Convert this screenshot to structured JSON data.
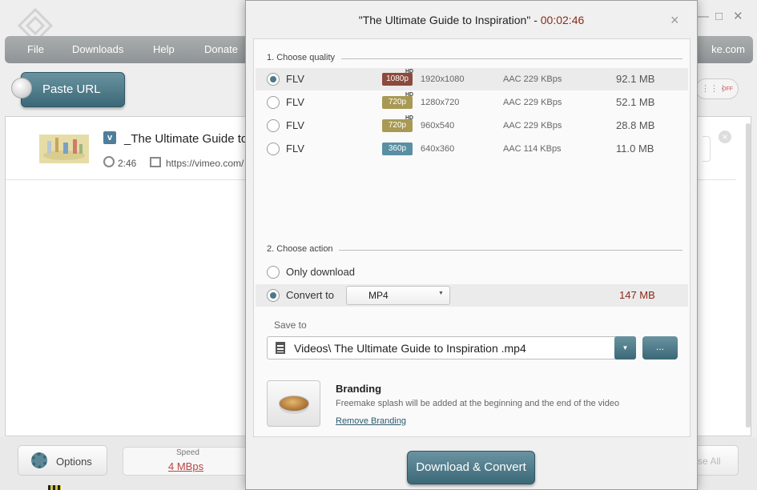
{
  "app": {
    "menu": [
      "File",
      "Downloads",
      "Help",
      "Donate"
    ],
    "brand": "ke.com",
    "paste_url": "Paste URL",
    "toggle_off": "OFF",
    "item": {
      "title": "_The Ultimate Guide to In",
      "duration": "2:46",
      "url": "https://vimeo.com/",
      "source_badge": "v"
    },
    "bottom": {
      "options": "Options",
      "speed_label": "Speed",
      "speed_value": "4  MBps",
      "all_button": "se All"
    }
  },
  "dialog": {
    "title": "\"The Ultimate Guide to Inspiration\" - ",
    "duration": "00:02:46",
    "close": "×",
    "quality_heading": "1. Choose quality",
    "quality_options": [
      {
        "format": "FLV",
        "badge": "1080p",
        "hd": "HD",
        "badge_color": "#8b4a3c",
        "resolution": "1920x1080",
        "audio": "AAC 229  KBps",
        "size": "92.1 MB",
        "selected": true
      },
      {
        "format": "FLV",
        "badge": "720p",
        "hd": "HD",
        "badge_color": "#a89a55",
        "resolution": "1280x720",
        "audio": "AAC 229  KBps",
        "size": "52.1 MB",
        "selected": false
      },
      {
        "format": "FLV",
        "badge": "720p",
        "hd": "HD",
        "badge_color": "#a89a55",
        "resolution": "960x540",
        "audio": "AAC 229  KBps",
        "size": "28.8 MB",
        "selected": false
      },
      {
        "format": "FLV",
        "badge": "360p",
        "hd": "",
        "badge_color": "#5a8fa3",
        "resolution": "640x360",
        "audio": "AAC 114  KBps",
        "size": "11.0 MB",
        "selected": false
      }
    ],
    "action_heading": "2. Choose action",
    "action_only_download": "Only download",
    "action_convert": "Convert to",
    "convert_format": "MP4",
    "convert_size": "147 MB",
    "save_to_label": "Save to",
    "save_path": "Videos\\ The Ultimate Guide to Inspiration .mp4",
    "browse": "...",
    "branding_heading": "Branding",
    "branding_desc": "Freemake splash will be added at the beginning and the end of the video",
    "branding_link": "Remove Branding",
    "download_button": "Download & Convert"
  }
}
